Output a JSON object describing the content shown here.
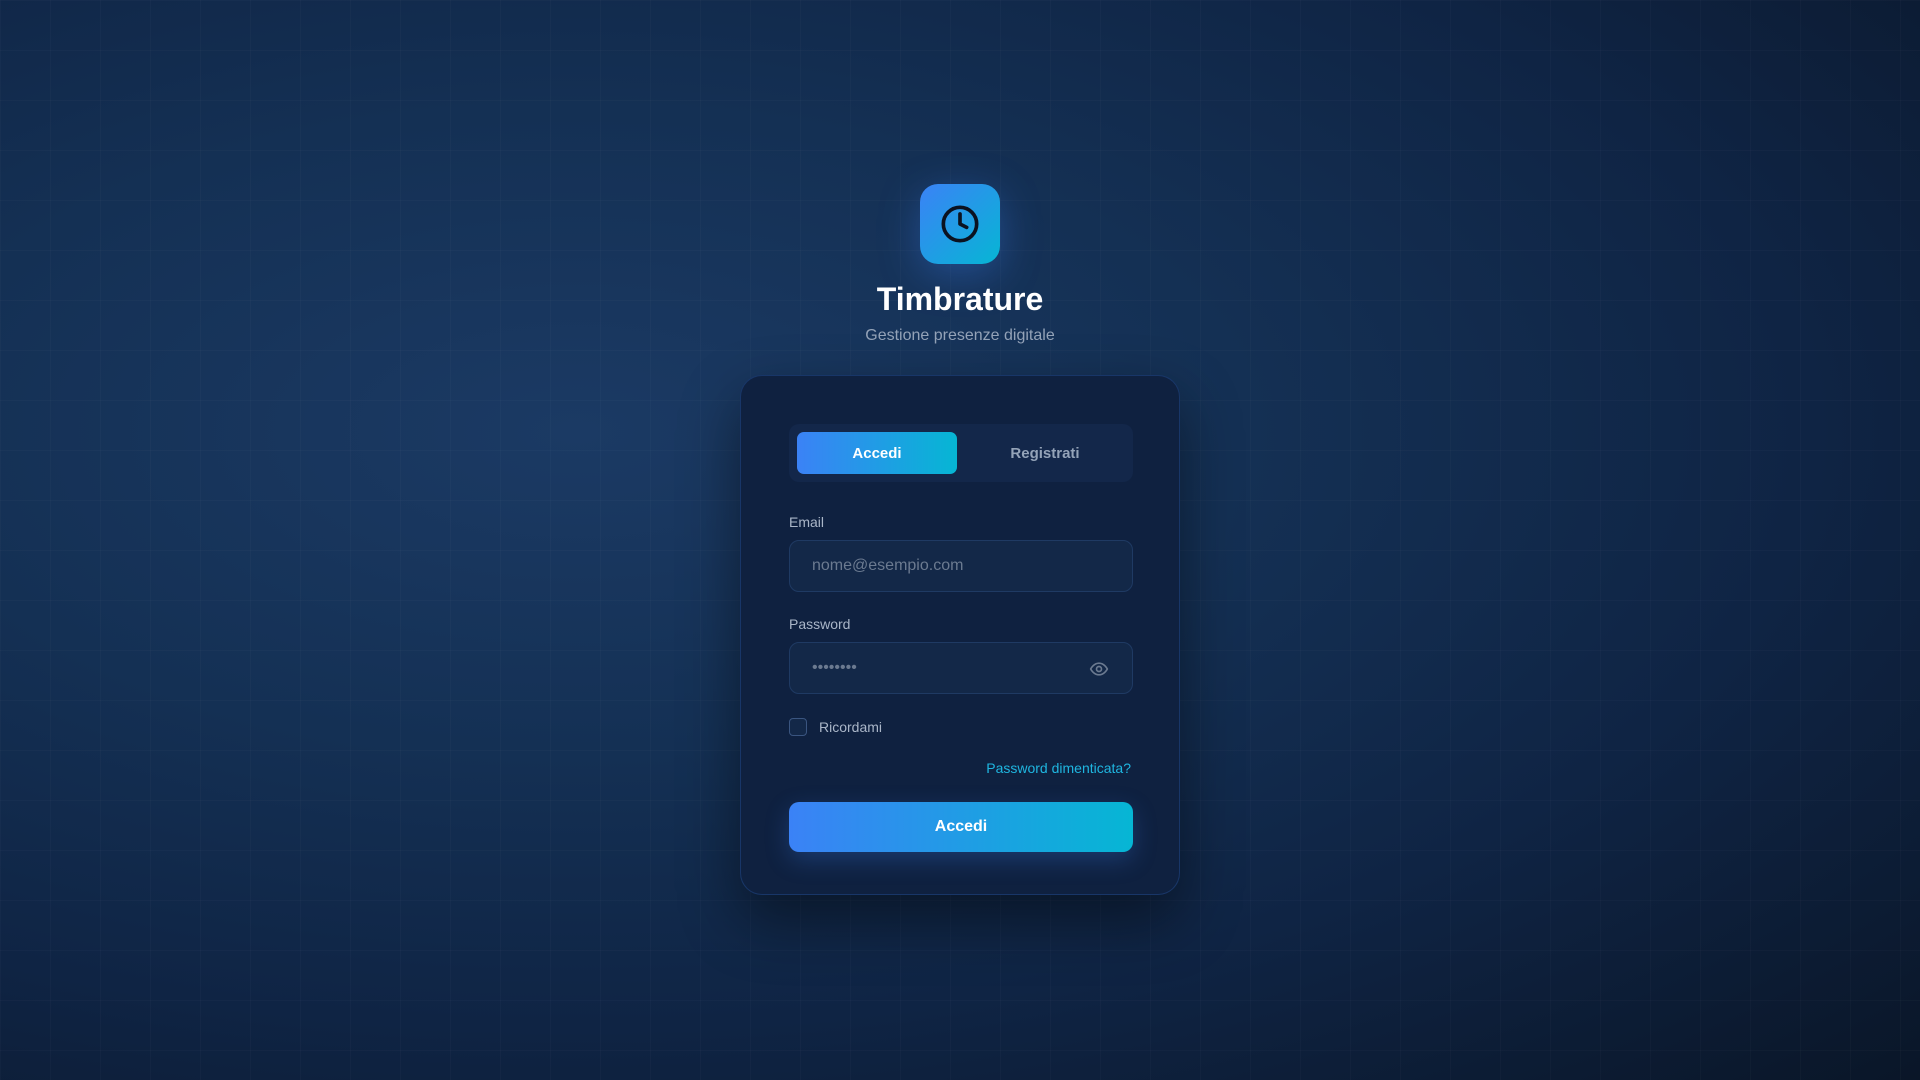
{
  "brand": {
    "icon": "clock-icon",
    "title": "Timbrature",
    "subtitle": "Gestione presenze digitale"
  },
  "tabs": [
    {
      "label": "Accedi",
      "active": true
    },
    {
      "label": "Registrati",
      "active": false
    }
  ],
  "form": {
    "email": {
      "label": "Email",
      "placeholder": "nome@esempio.com",
      "value": ""
    },
    "password": {
      "label": "Password",
      "placeholder": "••••••••",
      "value": "",
      "toggle_icon": "eye-icon"
    },
    "remember": {
      "label": "Ricordami",
      "checked": false
    },
    "forgot_link": "Password dimenticata?",
    "submit_label": "Accedi"
  },
  "colors": {
    "accent_start": "#3b82f6",
    "accent_end": "#06b6d4",
    "link": "#1fb6e0"
  }
}
